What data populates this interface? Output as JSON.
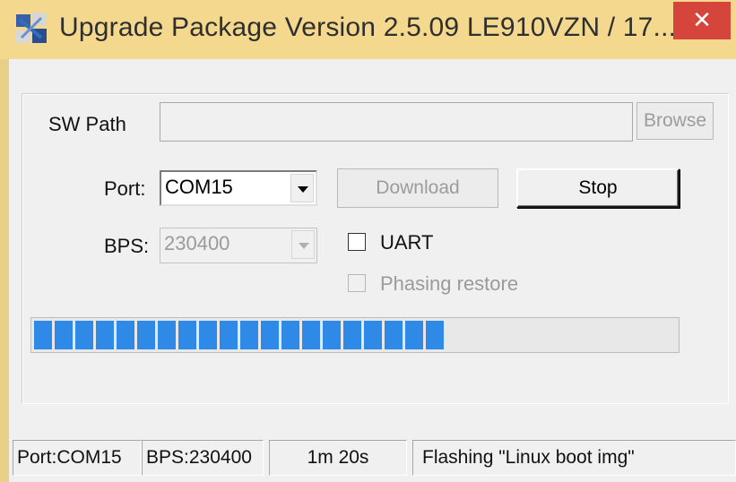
{
  "window": {
    "title": "Upgrade Package Version 2.5.09  LE910VZN / 17....",
    "close_glyph": "✕",
    "icon": "app-icon"
  },
  "form": {
    "sw_path_label": "SW Path",
    "sw_path_value": "",
    "browse_label": "Browse",
    "port_label": "Port:",
    "port_value": "COM15",
    "download_label": "Download",
    "stop_label": "Stop",
    "bps_label": "BPS:",
    "bps_value": "230400",
    "uart_label": "UART",
    "uart_checked": false,
    "phasing_label": "Phasing restore",
    "phasing_checked": false
  },
  "progress": {
    "fraction": 0.65,
    "color": "#2e8ae6"
  },
  "statusbar": {
    "port": "Port:COM15",
    "bps": "BPS:230400",
    "elapsed": "1m 20s",
    "message": "Flashing \"Linux boot img\""
  }
}
